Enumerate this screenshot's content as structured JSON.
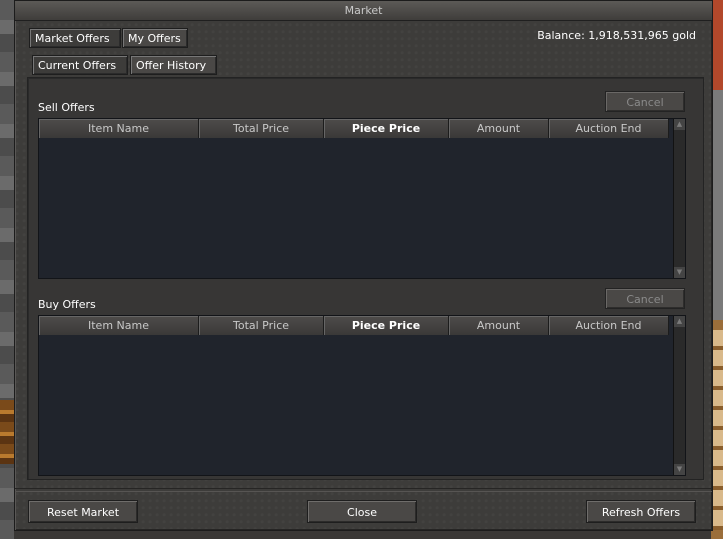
{
  "window": {
    "title": "Market"
  },
  "tabs_main": [
    {
      "label": "Market Offers",
      "active": true
    },
    {
      "label": "My Offers",
      "active": false
    }
  ],
  "tabs_sub": [
    {
      "label": "Current Offers",
      "active": true
    },
    {
      "label": "Offer History",
      "active": false
    }
  ],
  "balance": "Balance: 1,918,531,965 gold",
  "sell": {
    "title": "Sell Offers",
    "cancel_label": "Cancel",
    "columns": [
      "Item Name",
      "Total Price",
      "Piece Price",
      "Amount",
      "Auction End"
    ],
    "rows": []
  },
  "buy": {
    "title": "Buy Offers",
    "cancel_label": "Cancel",
    "columns": [
      "Item Name",
      "Total Price",
      "Piece Price",
      "Amount",
      "Auction End"
    ],
    "rows": []
  },
  "footer": {
    "reset_label": "Reset Market",
    "close_label": "Close",
    "refresh_label": "Refresh Offers"
  }
}
